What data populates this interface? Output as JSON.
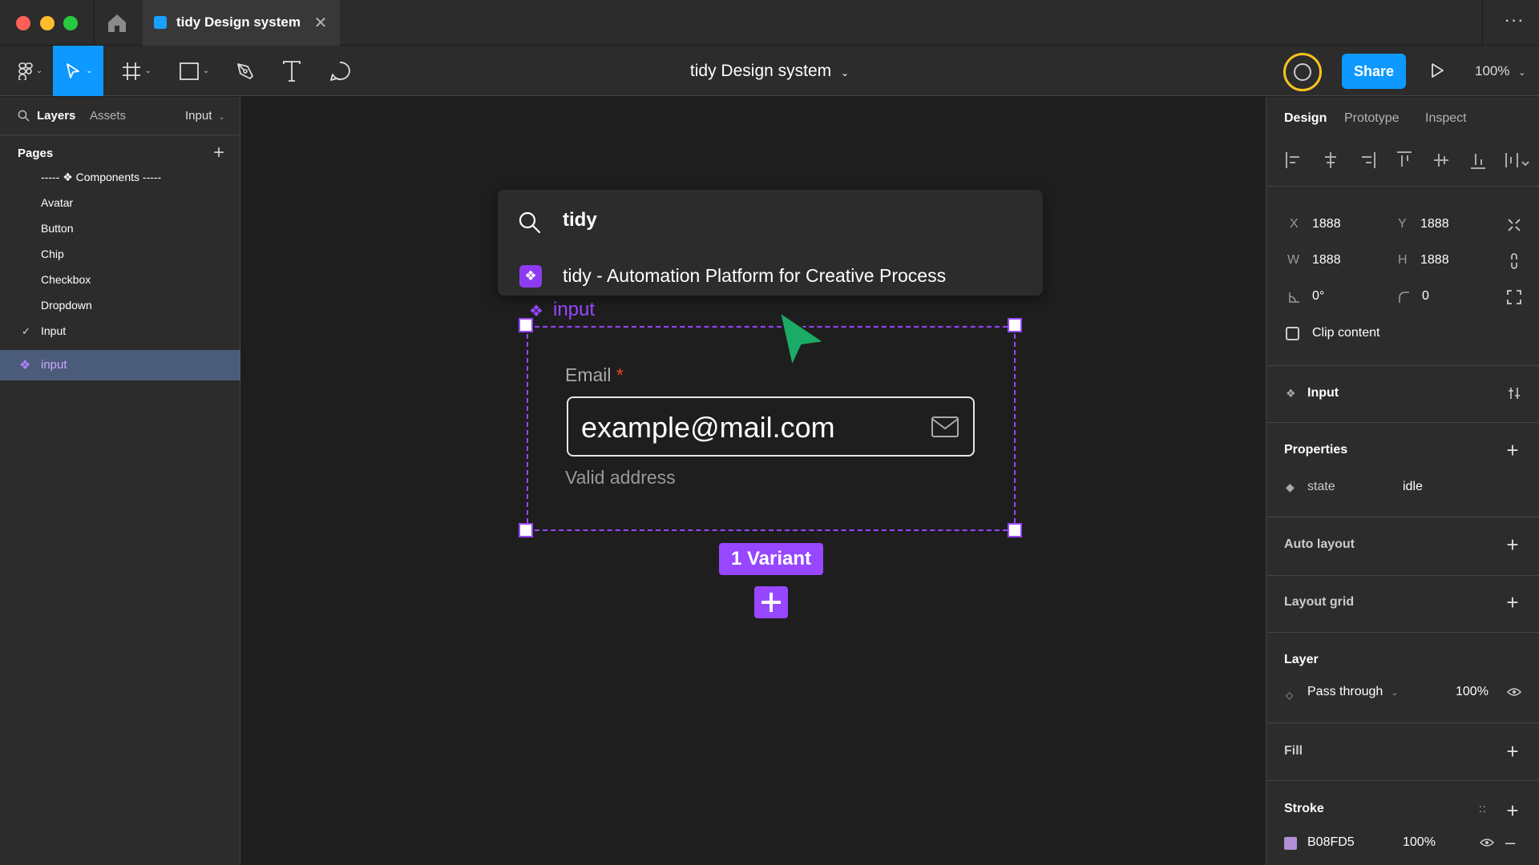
{
  "titlebar": {
    "tab_title": "tidy Design system",
    "tab_close": "✕",
    "more": "···"
  },
  "toolbar": {
    "file_title": "tidy Design system",
    "share_label": "Share",
    "zoom": "100%"
  },
  "left_panel": {
    "tabs": [
      "Layers",
      "Assets"
    ],
    "page_dropdown": "Input",
    "pages_header": "Pages",
    "pages": [
      "----- ❖ Components -----",
      "Avatar",
      "Button",
      "Chip",
      "Checkbox",
      "Dropdown",
      "Input"
    ],
    "selected_layer": "input"
  },
  "canvas": {
    "quick_actions": {
      "query": "tidy",
      "result": "tidy - Automation Platform for Creative Process"
    },
    "component_label": "input",
    "field": {
      "label": "Email",
      "required_mark": "*",
      "value": "example@mail.com",
      "helper": "Valid address"
    },
    "variant_badge": "1 Variant"
  },
  "right_panel": {
    "tabs": [
      "Design",
      "Prototype",
      "Inspect"
    ],
    "x_label": "X",
    "x_value": "1888",
    "y_label": "Y",
    "y_value": "1888",
    "w_label": "W",
    "w_value": "1888",
    "h_label": "H",
    "h_value": "1888",
    "rotation": "0°",
    "radius": "0",
    "clip_content": "Clip content",
    "component_name": "Input",
    "properties_header": "Properties",
    "property_name": "state",
    "property_value": "idle",
    "auto_layout": "Auto layout",
    "layout_grid": "Layout grid",
    "layer_header": "Layer",
    "blend_mode": "Pass through",
    "layer_opacity": "100%",
    "fill_header": "Fill",
    "stroke_header": "Stroke",
    "stroke_color": "B08FD5",
    "stroke_opacity": "100%"
  },
  "colors": {
    "accent_blue": "#0d99ff",
    "component_purple": "#9747ff",
    "stroke_swatch": "#b08fd5",
    "cursor_green": "#1bab67"
  }
}
